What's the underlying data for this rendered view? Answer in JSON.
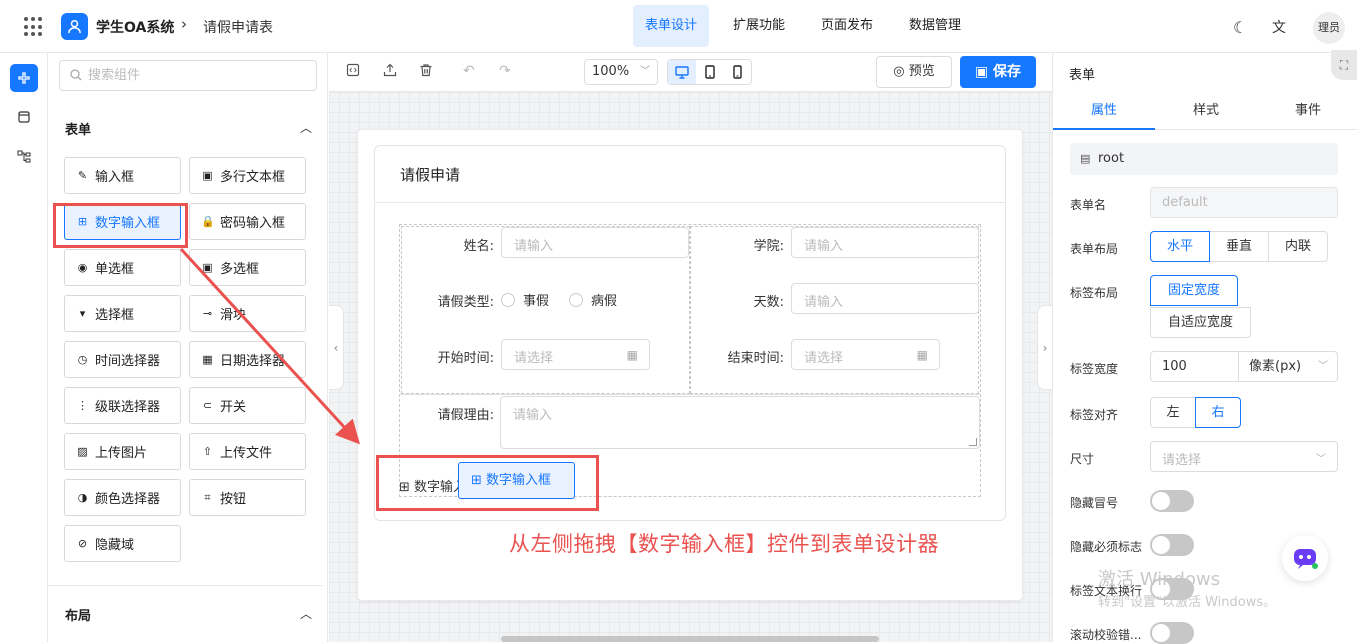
{
  "header": {
    "app_name": "学生OA系统",
    "crumb_sep": "›",
    "page_name": "请假申请表",
    "tabs": [
      {
        "label": "表单设计",
        "active": true
      },
      {
        "label": "扩展功能",
        "active": false
      },
      {
        "label": "页面发布",
        "active": false
      },
      {
        "label": "数据管理",
        "active": false
      }
    ],
    "avatar": "理员"
  },
  "components": {
    "search_placeholder": "搜索组件",
    "form_section": "表单",
    "layout_section": "布局",
    "items": [
      {
        "label": "输入框",
        "icon": "✎"
      },
      {
        "label": "多行文本框",
        "icon": "▣"
      },
      {
        "label": "数字输入框",
        "icon": "⊞"
      },
      {
        "label": "密码输入框",
        "icon": "🔒"
      },
      {
        "label": "单选框",
        "icon": "◉"
      },
      {
        "label": "多选框",
        "icon": "▣"
      },
      {
        "label": "选择框",
        "icon": "▾"
      },
      {
        "label": "滑块",
        "icon": "⊸"
      },
      {
        "label": "时间选择器",
        "icon": "◷"
      },
      {
        "label": "日期选择器",
        "icon": "▦"
      },
      {
        "label": "级联选择器",
        "icon": "⋮"
      },
      {
        "label": "开关",
        "icon": "⊂"
      },
      {
        "label": "上传图片",
        "icon": "▨"
      },
      {
        "label": "上传文件",
        "icon": "⇧"
      },
      {
        "label": "颜色选择器",
        "icon": "◑"
      },
      {
        "label": "按钮",
        "icon": "⌗"
      },
      {
        "label": "隐藏域",
        "icon": "⊘"
      }
    ]
  },
  "toolbar": {
    "zoom": "100%",
    "preview": "预览",
    "save": "保存"
  },
  "form": {
    "title": "请假申请",
    "fields": {
      "name_label": "姓名:",
      "name_placeholder": "请输入",
      "college_label": "学院:",
      "college_placeholder": "请输入",
      "type_label": "请假类型:",
      "type_option1": "事假",
      "type_option2": "病假",
      "days_label": "天数:",
      "days_placeholder": "请输入",
      "start_label": "开始时间:",
      "start_placeholder": "请选择",
      "end_label": "结束时间:",
      "end_placeholder": "请选择",
      "reason_label": "请假理由:",
      "reason_placeholder": "请输入"
    },
    "drag_ghost_label": "数字输入框",
    "drag_chip_label": "数字输入框"
  },
  "annotation": "从左侧拖拽【数字输入框】控件到表单设计器",
  "props": {
    "panel_title": "表单",
    "tabs": [
      "属性",
      "样式",
      "事件"
    ],
    "root": "root",
    "form_name_label": "表单名",
    "form_name_value": "default",
    "form_layout_label": "表单布局",
    "form_layout_options": [
      "水平",
      "垂直",
      "内联"
    ],
    "label_layout_label": "标签布局",
    "label_layout_options": [
      "固定宽度",
      "自适应宽度"
    ],
    "label_width_label": "标签宽度",
    "label_width_value": "100",
    "label_width_unit": "像素(px)",
    "label_align_label": "标签对齐",
    "label_align_options": [
      "左",
      "右"
    ],
    "size_label": "尺寸",
    "size_placeholder": "请选择",
    "hide_colon_label": "隐藏冒号",
    "hide_required_label": "隐藏必须标志",
    "label_wrap_label": "标签文本换行",
    "scroll_validate_label": "滚动校验错..."
  },
  "watermark": {
    "line1": "激活 Windows",
    "line2": "转到\"设置\"以激活 Windows。"
  },
  "colors": {
    "accent": "#1677ff",
    "annotation": "#e9524f"
  }
}
